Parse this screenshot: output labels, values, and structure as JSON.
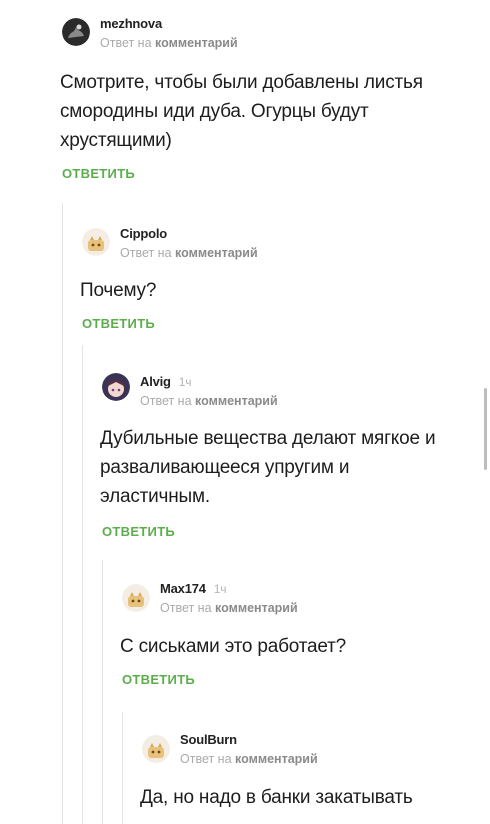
{
  "reply_prefix": "Ответ на",
  "reply_target": "комментарий",
  "comments": [
    {
      "author": "mezhnova",
      "time": "",
      "text": "Смотрите, чтобы были добавлены листья смородины иди дуба. Огурцы будут хрустящими)",
      "reply_label": "ОТВЕТИТЬ",
      "avatar_icon": "dark-photo-avatar"
    },
    {
      "author": "Cippolo",
      "time": "",
      "text": "Почему?",
      "reply_label": "ОТВЕТИТЬ",
      "avatar_icon": "default-face-avatar"
    },
    {
      "author": "Alvig",
      "time": "1ч",
      "text": "Дубильные вещества делают мягкое и разваливающееся упругим и эластичным.",
      "reply_label": "ОТВЕТИТЬ",
      "avatar_icon": "anime-girl-avatar"
    },
    {
      "author": "Max174",
      "time": "1ч",
      "text": "С сиськами это работает?",
      "reply_label": "ОТВЕТИТЬ",
      "avatar_icon": "default-face-avatar"
    },
    {
      "author": "SoulBurn",
      "time": "",
      "text": "Да, но надо в банки закатывать",
      "reply_label": "",
      "avatar_icon": "default-face-avatar"
    }
  ],
  "colors": {
    "reply_button": "#5cae4c",
    "meta_text": "#aaaaaa",
    "thread_line": "#e4e4e4"
  }
}
